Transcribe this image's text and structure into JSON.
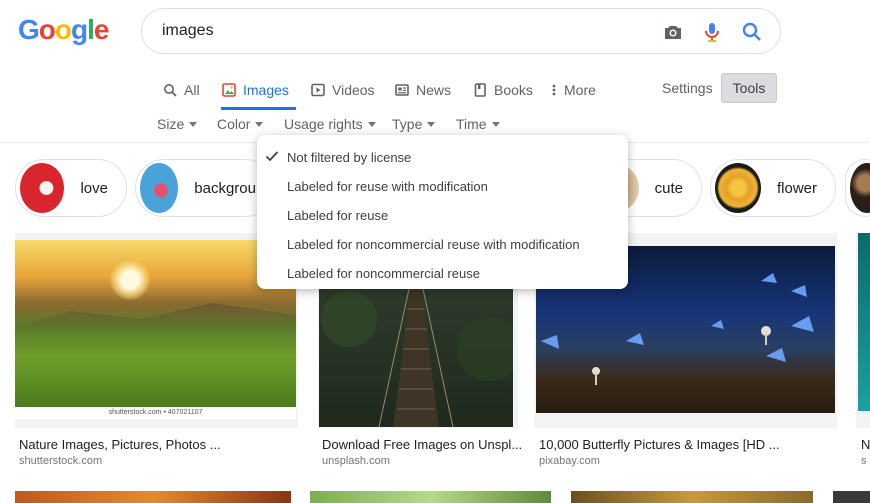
{
  "logo": {
    "text": "Google"
  },
  "search": {
    "query": "images",
    "camera_icon": "camera-icon",
    "mic_icon": "microphone-icon",
    "search_icon": "search-icon"
  },
  "tabs": [
    {
      "label": "All",
      "icon": "search-icon"
    },
    {
      "label": "Images",
      "icon": "image-icon",
      "active": true
    },
    {
      "label": "Videos",
      "icon": "play-icon"
    },
    {
      "label": "News",
      "icon": "news-icon"
    },
    {
      "label": "Books",
      "icon": "book-icon"
    },
    {
      "label": "More",
      "icon": "more-vert-icon"
    }
  ],
  "settings_label": "Settings",
  "tools_label": "Tools",
  "filters": [
    {
      "label": "Size"
    },
    {
      "label": "Color"
    },
    {
      "label": "Usage rights"
    },
    {
      "label": "Type"
    },
    {
      "label": "Time"
    }
  ],
  "chips": [
    {
      "label": "love",
      "color": "#d9262e"
    },
    {
      "label": "backgrou",
      "color": "#4aa3d8"
    },
    {
      "label": "cute",
      "color": "#c9a878"
    },
    {
      "label": "flower",
      "color": "#e3a128"
    }
  ],
  "usage_rights_menu": [
    {
      "label": "Not filtered by license",
      "checked": true
    },
    {
      "label": "Labeled for reuse with modification"
    },
    {
      "label": "Labeled for reuse"
    },
    {
      "label": "Labeled for noncommercial reuse with modification"
    },
    {
      "label": "Labeled for noncommercial reuse"
    }
  ],
  "results": [
    {
      "title": "Nature Images, Pictures, Photos ...",
      "site": "shutterstock.com",
      "watermark": "shutterstock.com • 407021107"
    },
    {
      "title": "Download Free Images on Unspl...",
      "site": "unsplash.com"
    },
    {
      "title": "10,000 Butterfly Pictures & Images [HD ...",
      "site": "pixabay.com"
    },
    {
      "title": "N",
      "site": "s"
    }
  ],
  "colors": {
    "accent": "#1a73e8",
    "text": "#202124",
    "muted": "#5f6368"
  }
}
